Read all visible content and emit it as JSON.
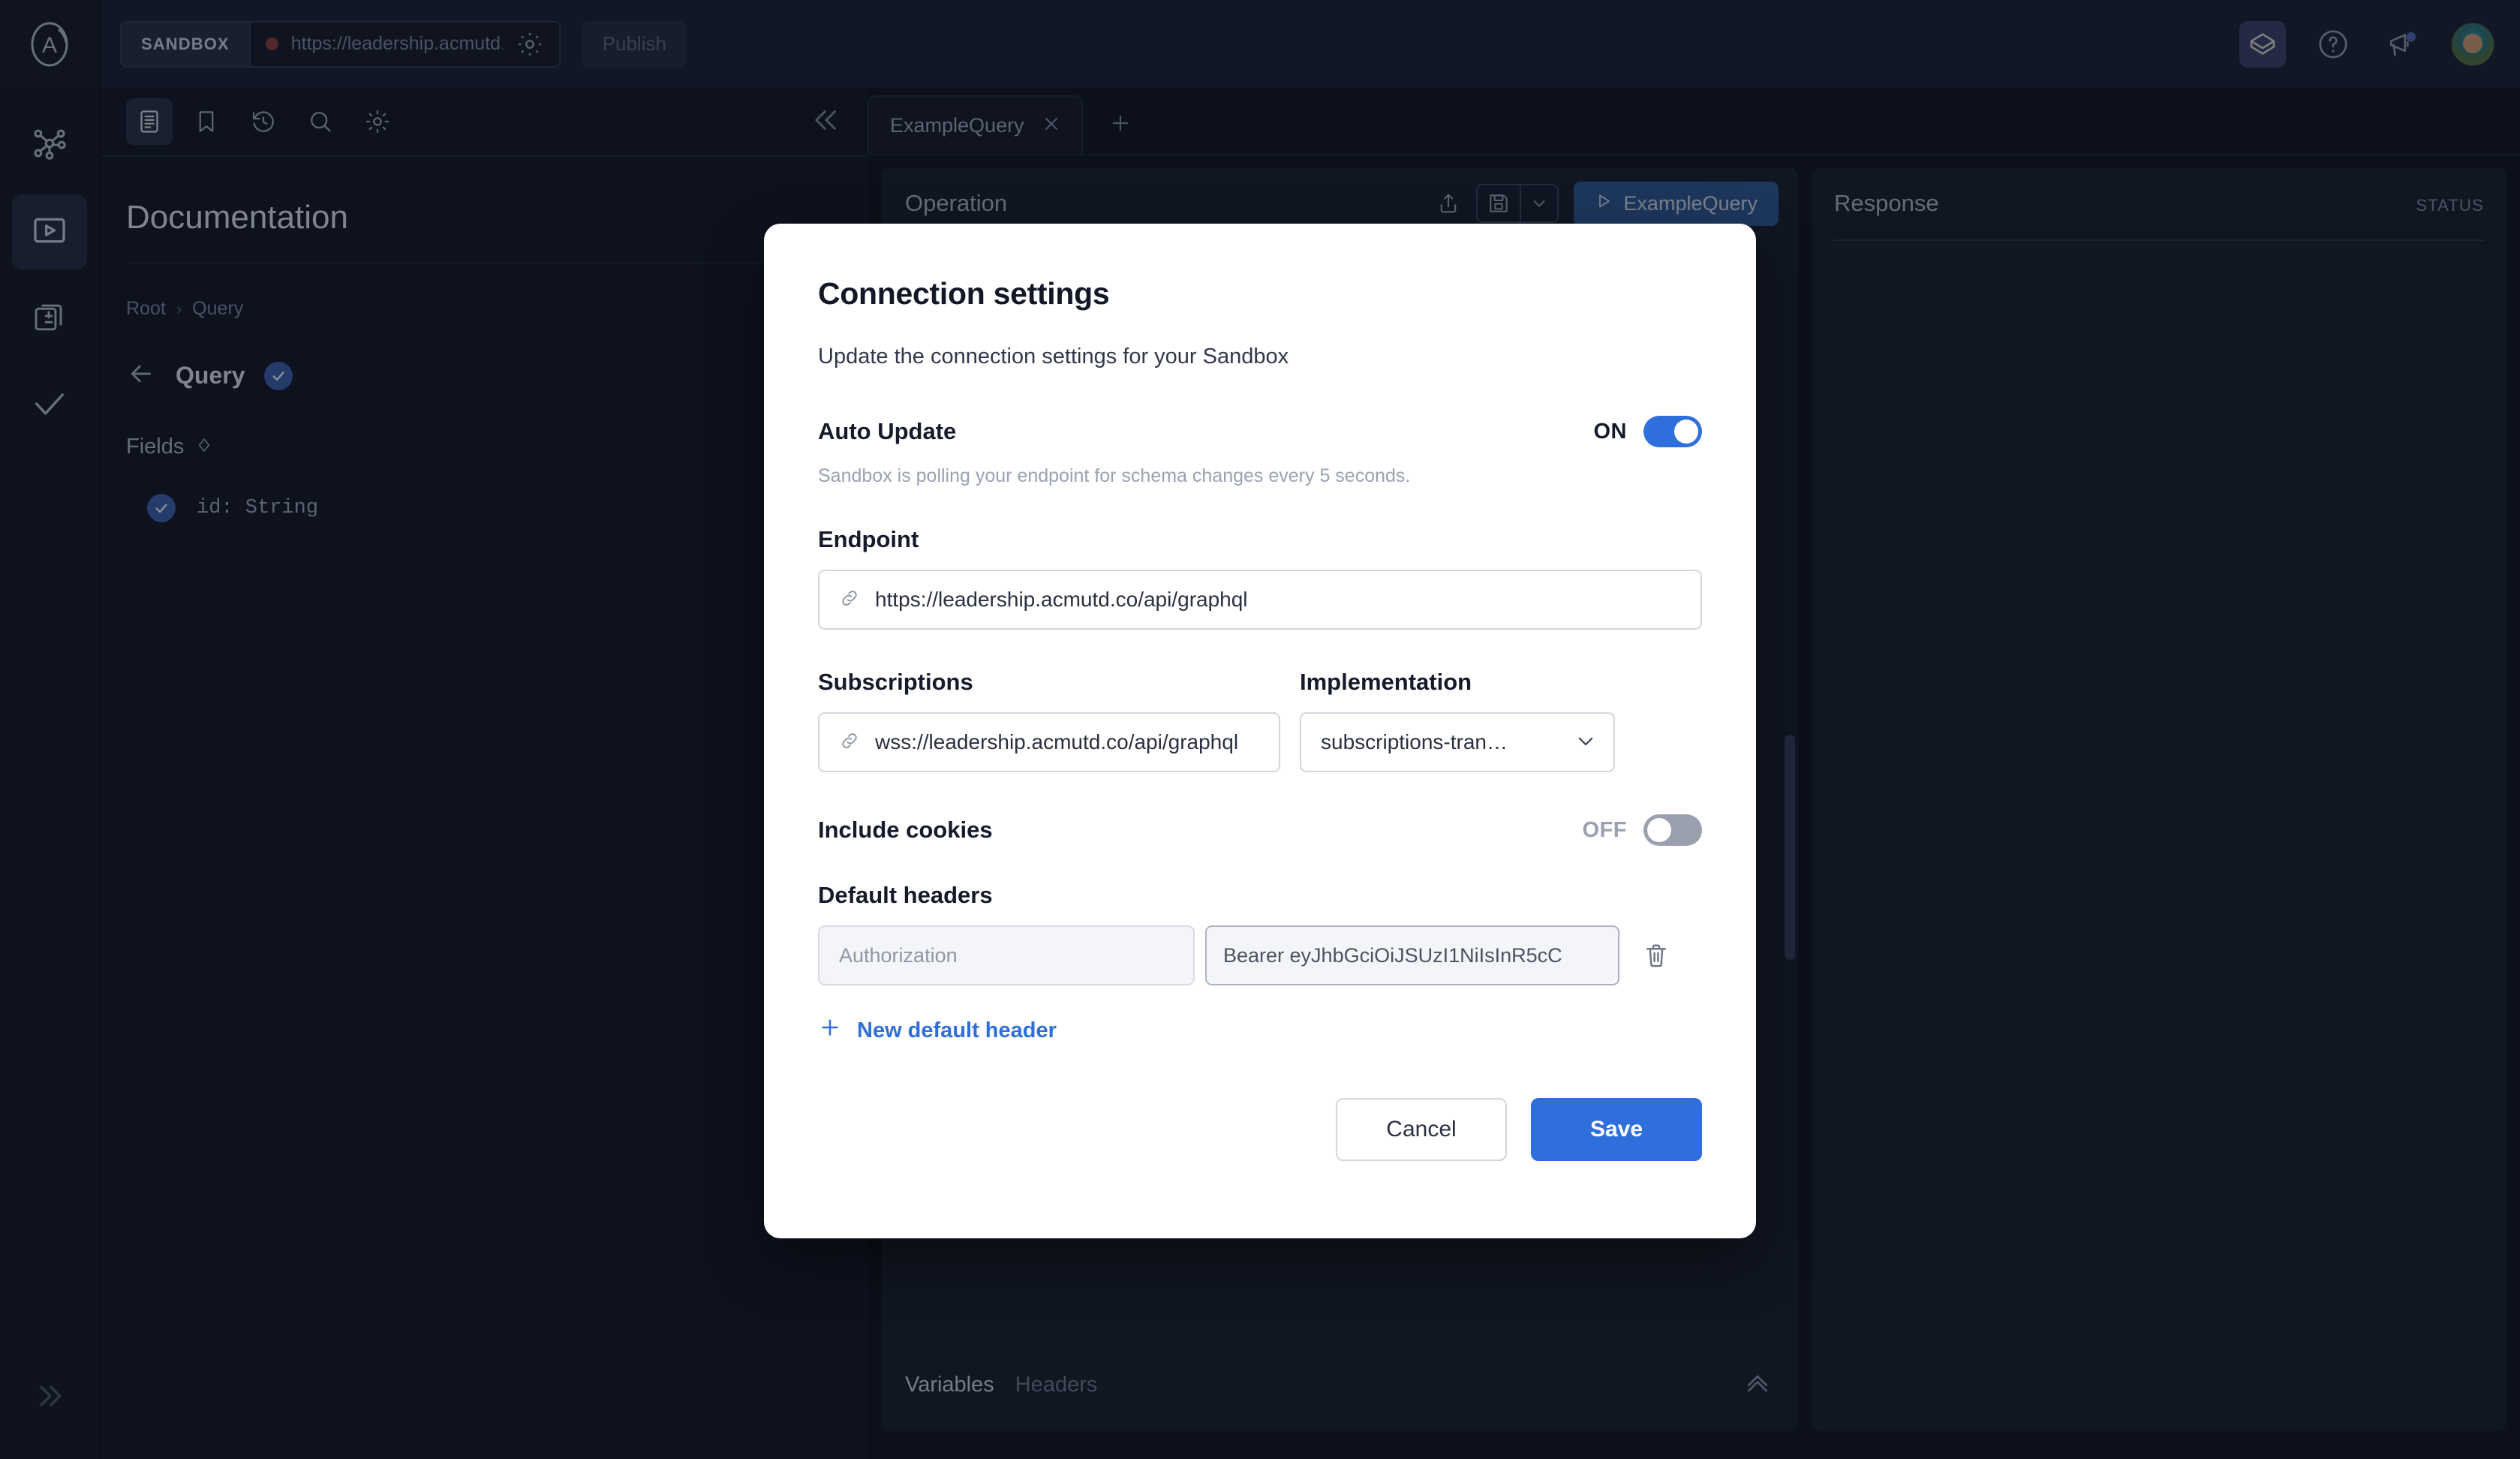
{
  "topbar": {
    "logo_icon": "apollo-logo-icon",
    "sandbox_chip": "SANDBOX",
    "endpoint_display": "https://leadership.acmutd.co/a",
    "settings_icon": "gear-icon",
    "publish_label": "Publish",
    "icons": [
      "sandbox-cube-icon",
      "help-circle-icon",
      "announcement-megaphone-icon",
      "user-avatar"
    ]
  },
  "rail": {
    "items": [
      {
        "name": "schema-graph-icon"
      },
      {
        "name": "explorer-play-icon"
      },
      {
        "name": "variants-stack-icon"
      },
      {
        "name": "checks-checkmark-icon"
      }
    ],
    "expand_icon": "chevron-double-right-icon"
  },
  "docpanel": {
    "tools": [
      "documentation-icon",
      "bookmark-icon",
      "history-icon",
      "search-icon",
      "settings-gear-icon"
    ],
    "collapse_icon": "chevron-double-left-icon",
    "title": "Documentation",
    "breadcrumb": [
      "Root",
      "Query"
    ],
    "breadcrumb_separator": "›",
    "current_type": "Query",
    "fields_heading": "Fields",
    "fields": [
      {
        "signature": "id: String"
      }
    ]
  },
  "editor": {
    "tabs": [
      {
        "label": "ExampleQuery",
        "close_icon": "close-x-icon"
      }
    ],
    "add_tab_icon": "plus-icon",
    "operation": {
      "title": "Operation",
      "share_icon": "share-up-icon",
      "save_icon": "floppy-save-icon",
      "save_caret_icon": "chevron-down-icon",
      "run_label": "ExampleQuery",
      "run_icon": "play-triangle-icon",
      "keyboard_icon": "keyboard-icon"
    },
    "variables_bar": {
      "tabs": [
        "Variables",
        "Headers"
      ],
      "active_tab": "Variables",
      "collapse_icon": "chevron-up-icon"
    },
    "response": {
      "title": "Response",
      "status_label": "STATUS"
    }
  },
  "modal": {
    "title": "Connection settings",
    "subtitle": "Update the connection settings for your Sandbox",
    "auto_update": {
      "label": "Auto Update",
      "state_text": "ON",
      "state_on": true,
      "hint": "Sandbox is polling your endpoint for schema changes every 5 seconds."
    },
    "endpoint": {
      "label": "Endpoint",
      "link_icon": "link-chain-icon",
      "value": "https://leadership.acmutd.co/api/graphql"
    },
    "subscriptions": {
      "label": "Subscriptions",
      "link_icon": "link-chain-icon",
      "value": "wss://leadership.acmutd.co/api/graphql"
    },
    "implementation": {
      "label": "Implementation",
      "value": "subscriptions-tran…",
      "chevron_icon": "chevron-down-icon"
    },
    "include_cookies": {
      "label": "Include cookies",
      "state_text": "OFF",
      "state_on": false
    },
    "default_headers": {
      "label": "Default headers",
      "rows": [
        {
          "key_placeholder": "Authorization",
          "value": "Bearer eyJhbGciOiJSUzI1NiIsInR5cC",
          "delete_icon": "trash-icon"
        }
      ],
      "add_label": "New default header",
      "add_icon": "plus-icon"
    },
    "cancel_label": "Cancel",
    "save_label": "Save"
  },
  "colors": {
    "accent_blue": "#2f6fdb",
    "dark_bg": "#0f1420",
    "panel_bg": "#181e2e",
    "status_dot": "#8c3b3b"
  }
}
